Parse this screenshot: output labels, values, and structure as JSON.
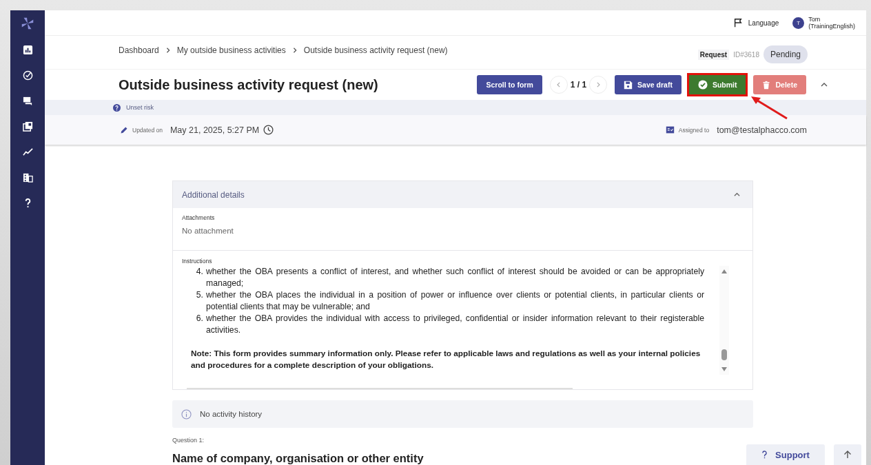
{
  "topbar": {
    "language": "Language",
    "user": {
      "initial": "T",
      "name": "Tom",
      "subtitle": "(TrainingEnglish)"
    }
  },
  "breadcrumb": [
    "Dashboard",
    "My outside business activities",
    "Outside business activity request (new)"
  ],
  "request": {
    "label": "Request",
    "id": "ID#3618",
    "status": "Pending"
  },
  "title": "Outside business activity request (new)",
  "toolbar": {
    "scroll_button": "Scroll to form",
    "pager": "1 / 1",
    "collapsed": false,
    "buttons": [
      {
        "kind": "save",
        "label": "Save draft",
        "highlighted": false,
        "disabled": false
      },
      {
        "kind": "submit",
        "label": "Submit",
        "highlighted": true,
        "disabled": false
      },
      {
        "kind": "delete",
        "label": "Delete",
        "highlighted": false,
        "disabled": true
      }
    ]
  },
  "risk": "Unset risk",
  "updated": {
    "label": "Updated on",
    "value": "May 21, 2025, 5:27 PM"
  },
  "assigned": {
    "label": "Assigned to",
    "value": "tom@testalphacco.com"
  },
  "card": {
    "title": "Additional details",
    "expanded": true,
    "attachments": {
      "label": "Attachments",
      "value": "No attachment"
    },
    "instructions": {
      "label": "Instructions",
      "items": [
        {
          "number": "4.",
          "text": "whether the OBA presents a conflict of interest, and whether such conflict of interest should be avoided or can be appropriately managed;"
        },
        {
          "number": "5.",
          "text": "whether the OBA places the individual in a position of power or influence over clients or potential clients, in particular clients or potential clients that may be vulnerable; and"
        },
        {
          "number": "6.",
          "text": "whether the OBA provides the individual with access to privileged, confidential or insider information relevant to their registerable activities."
        }
      ],
      "note": "Note: This form provides summary information only. Please refer to applicable laws and regulations as well as your internal policies and procedures for a complete description of your obligations."
    }
  },
  "activity": "No activity history",
  "question": {
    "label": "Question 1:",
    "title": "Name of company, organisation or other entity"
  },
  "support": "Support"
}
